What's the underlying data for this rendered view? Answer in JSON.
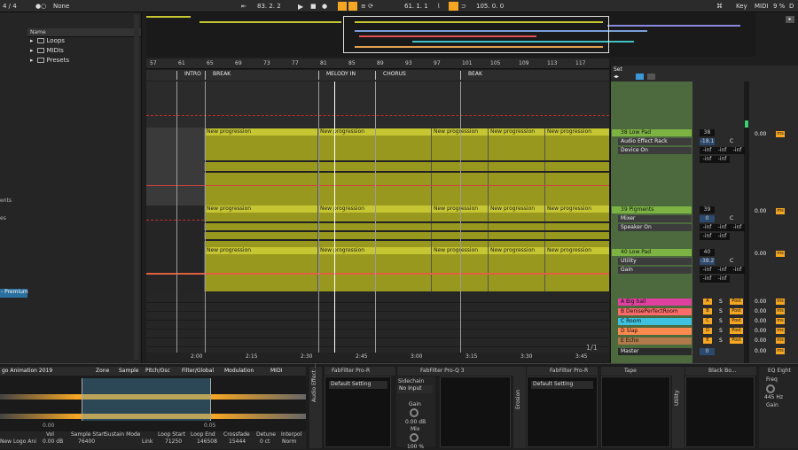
{
  "transport": {
    "signature": "4 / 4",
    "none": "None",
    "position": "83.  2.  2",
    "loop_start": "61.  1.  1",
    "loop_length": "105.  0.  0",
    "key": "Key",
    "midi": "MIDI",
    "cpu": "9 %",
    "d": "D"
  },
  "browser": {
    "header": "Name",
    "folders": [
      "Loops",
      "MIDIs",
      "Presets"
    ],
    "cut_labels": [
      "ents",
      "es"
    ],
    "premium": "- Premium"
  },
  "ruler": {
    "bars": [
      "57",
      "61",
      "65",
      "69",
      "73",
      "77",
      "81",
      "85",
      "89",
      "93",
      "97",
      "101",
      "105",
      "109",
      "113",
      "117"
    ]
  },
  "locators": [
    "INTRO",
    "BREAK",
    "MELODY IN",
    "CHORUS",
    "BEAK"
  ],
  "clips": {
    "label": "New progression"
  },
  "timeline": [
    "2:00",
    "2:15",
    "2:30",
    "2:45",
    "3:00",
    "3:15",
    "3:30",
    "3:45"
  ],
  "page_counter": "1/1",
  "mixer": {
    "set": "Set",
    "tracks": [
      {
        "name": "38 Low Pad",
        "devices": [
          "Audio Effect Rack",
          "Device On"
        ],
        "vol": "38",
        "meter": "-18.1",
        "pan": "C",
        "send": "0.00",
        "color": "#7cb342"
      },
      {
        "name": "39 Pigments",
        "devices": [
          "Mixer",
          "Speaker On"
        ],
        "vol": "39",
        "meter": "0",
        "pan": "C",
        "send": "0.00",
        "color": "#7cb342"
      },
      {
        "name": "40 Low Pad",
        "devices": [
          "Utility",
          "Gain"
        ],
        "vol": "40",
        "meter": "-38.2",
        "pan": "C",
        "send": "0.00",
        "color": "#7cb342"
      }
    ],
    "inf": "-inf",
    "ms_label": "ms",
    "post": "Post",
    "s": "S",
    "returns": [
      {
        "name": "A Big hall",
        "letter": "A",
        "color": "#e040a0",
        "value": "0.00"
      },
      {
        "name": "B DenisePerfectRoom",
        "letter": "B",
        "color": "#ff6b6b",
        "value": "0.00"
      },
      {
        "name": "C Room",
        "letter": "C",
        "color": "#3fc1e0",
        "value": "0.00"
      },
      {
        "name": "D Slap",
        "letter": "D",
        "color": "#ff8a50",
        "value": "0.00"
      },
      {
        "name": "E Echo",
        "letter": "E",
        "color": "#b07a4a",
        "value": "0.00"
      },
      {
        "name": "Master",
        "letter": "0",
        "color": "#2a2a2a",
        "value": "0.00"
      }
    ]
  },
  "clip_view": {
    "title": "go Animation 2019",
    "tabs": [
      "Zone",
      "Sample",
      "Pitch/Osc",
      "Filter/Global",
      "Modulation",
      "MIDI"
    ],
    "params": [
      {
        "l": "Vol",
        "v": "0.00 dB"
      },
      {
        "l": "Sample Start",
        "v": "76400"
      },
      {
        "l": "Sustain Mode",
        "v": ""
      },
      {
        "l": "Loop Start",
        "v": "71250"
      },
      {
        "l": "Loop End",
        "v": "146508"
      },
      {
        "l": "Crossfade",
        "v": "15444"
      },
      {
        "l": "Detune",
        "v": "0 ct"
      },
      {
        "l": "Interpol",
        "v": "Norm"
      }
    ],
    "sample_name": "New Logo Ani",
    "link": "Link",
    "t1": "0.00",
    "t2": "0.05"
  },
  "devices": [
    {
      "title": "FabFilter Pro-R",
      "preset": "Default Setting"
    },
    {
      "title": "FabFilter Pro-Q 3",
      "preset": "Sidechain",
      "sub": "No Input",
      "gain": "Gain",
      "gain_v": "0.00 dB",
      "mix": "Mix",
      "mix_v": "100 %"
    },
    {
      "title": "FabFilter Pro-R",
      "preset": "Default Setting"
    },
    {
      "title": "Tape",
      "preset": ""
    },
    {
      "title": "Black Bo...",
      "preset": ""
    },
    {
      "title": "EQ Eight",
      "preset": "",
      "freq": "Freq",
      "freq_v": "445 Hz",
      "gain": "Gain"
    }
  ],
  "rack_labels": [
    "Audio Effect ...",
    "Erosion",
    "Utility"
  ]
}
